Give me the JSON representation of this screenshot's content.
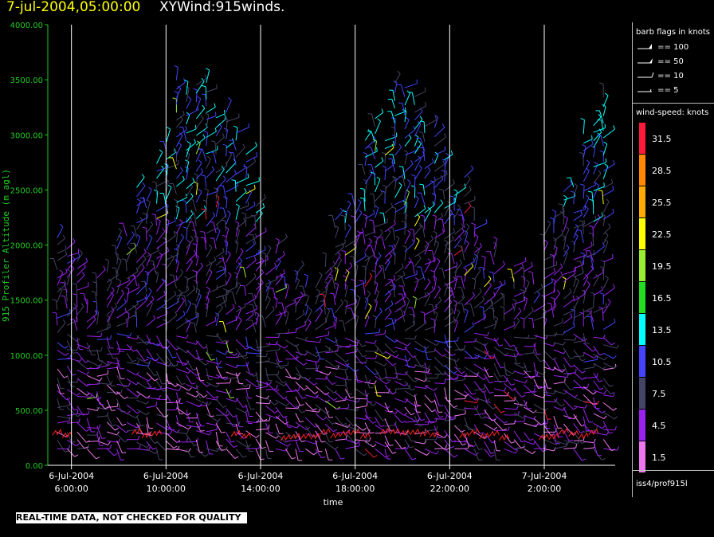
{
  "header": {
    "timestamp": "7-jul-2004,05:00:00",
    "title": "XYWind:915winds."
  },
  "chart_data": {
    "type": "scatter",
    "subtype": "wind-barbs",
    "ylabel": "915 Profiler Altitude (m agl)",
    "xlabel": "time",
    "ylim": [
      0,
      4000
    ],
    "yticks": [
      "0.00",
      "500.00",
      "1000.00",
      "1500.00",
      "2000.00",
      "2500.00",
      "3000.00",
      "3500.00",
      "4000.00"
    ],
    "xticks": [
      {
        "date": "6-Jul-2004",
        "time": "6:00:00"
      },
      {
        "date": "6-Jul-2004",
        "time": "10:00:00"
      },
      {
        "date": "6-Jul-2004",
        "time": "14:00:00"
      },
      {
        "date": "6-Jul-2004",
        "time": "18:00:00"
      },
      {
        "date": "6-Jul-2004",
        "time": "22:00:00"
      },
      {
        "date": "7-Jul-2004",
        "time": "2:00:00"
      }
    ],
    "xlim_hours": [
      5.0,
      29.0
    ],
    "grid": "vertical lines at time ticks",
    "colors": {
      "axis": "#22cc22",
      "title_time": "#ffff00",
      "gridline": "#ffffff"
    }
  },
  "panel": {
    "flags_title": "barb flags in knots",
    "flags": [
      "== 100",
      "== 50",
      "== 10",
      "== 5"
    ],
    "speed_title": "wind-speed: knots",
    "legend": [
      {
        "value": "31.5",
        "color": "#ff1a3a"
      },
      {
        "value": "28.5",
        "color": "#ff8800"
      },
      {
        "value": "25.5",
        "color": "#ffaa00"
      },
      {
        "value": "22.5",
        "color": "#ffff00"
      },
      {
        "value": "19.5",
        "color": "#99ee33"
      },
      {
        "value": "16.5",
        "color": "#22dd22"
      },
      {
        "value": "13.5",
        "color": "#00ffff"
      },
      {
        "value": "10.5",
        "color": "#4444ff"
      },
      {
        "value": "7.5",
        "color": "#444466"
      },
      {
        "value": "4.5",
        "color": "#9922ee"
      },
      {
        "value": "1.5",
        "color": "#ee77ee"
      }
    ],
    "source": "iss4/prof915l"
  },
  "footer": "REAL-TIME DATA, NOT CHECKED FOR QUALITY"
}
